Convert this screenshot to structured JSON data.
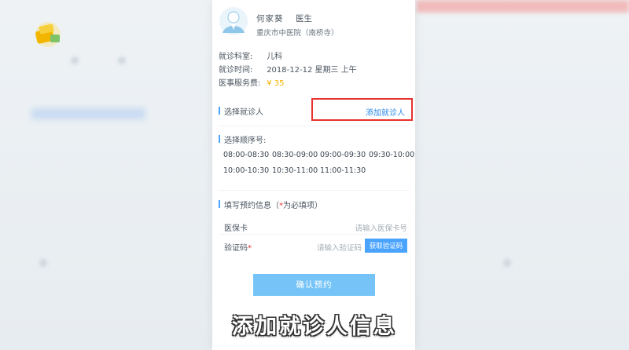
{
  "doctor": {
    "name": "何家葵",
    "title": "医生",
    "hospital": "重庆市中医院（南桥寺）"
  },
  "visit": {
    "dept_label": "就诊科室:",
    "dept_value": "儿科",
    "time_label": "就诊时间:",
    "time_value": "2018-12-12 星期三 上午",
    "fee_label": "医事服务费:",
    "fee_value": "¥ 35"
  },
  "patient_section": {
    "title": "选择就诊人",
    "add_label": "添加就诊人"
  },
  "slot_section": {
    "title": "选择顺序号:",
    "slots": [
      "08:00-08:30",
      "08:30-09:00",
      "09:00-09:30",
      "09:30-10:00",
      "10:00-10:30",
      "10:30-11:00",
      "11:00-11:30"
    ]
  },
  "form": {
    "title": "填写预约信息（",
    "title_req_mark": "*",
    "title_suffix": "为必填项）",
    "insurance_label": "医保卡",
    "insurance_placeholder": "请输入医保卡号",
    "code_label": "验证码",
    "code_req_mark": "*",
    "code_placeholder": "请输入验证码",
    "get_code_label": "获取验证码"
  },
  "confirm_label": "确认预约",
  "caption": "添加就诊人信息",
  "colors": {
    "accent": "#4aa3ff",
    "highlight_box": "#e8322f",
    "fee": "#f2b200",
    "confirm_button": "#76c4f7"
  }
}
